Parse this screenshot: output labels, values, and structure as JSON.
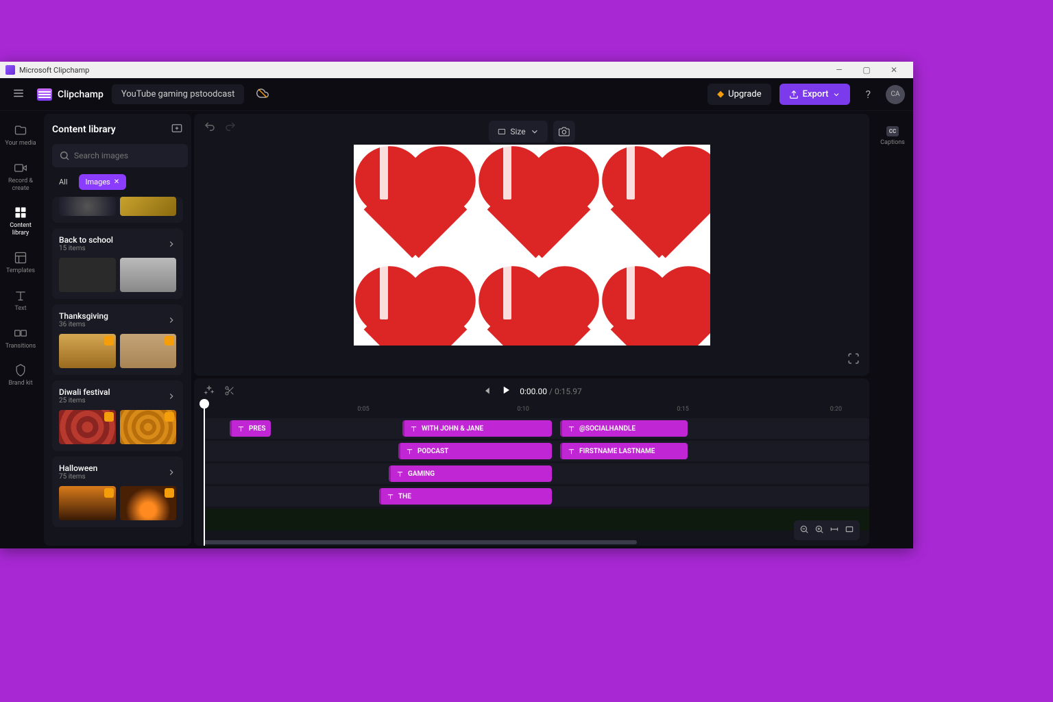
{
  "titlebar": {
    "title": "Microsoft Clipchamp"
  },
  "topbar": {
    "app_name": "Clipchamp",
    "project_name": "YouTube gaming pstoodcast",
    "upgrade": "Upgrade",
    "export": "Export",
    "avatar": "CA"
  },
  "left_nav": {
    "your_media": "Your media",
    "record_create": "Record & create",
    "content_library": "Content library",
    "templates": "Templates",
    "text": "Text",
    "transitions": "Transitions",
    "brand_kit": "Brand kit"
  },
  "right_nav": {
    "captions": "Captions",
    "cc": "CC"
  },
  "panel": {
    "title": "Content library",
    "search_placeholder": "Search images",
    "chips": {
      "all": "All",
      "images": "Images"
    },
    "cats": [
      {
        "title": "Back to school",
        "count": "15 items"
      },
      {
        "title": "Thanksgiving",
        "count": "36 items"
      },
      {
        "title": "Diwali festival",
        "count": "25 items"
      },
      {
        "title": "Halloween",
        "count": "75 items"
      }
    ]
  },
  "canvas": {
    "size_label": "Size"
  },
  "playback": {
    "current": "0:00.00",
    "sep": " / ",
    "duration": "0:15.97"
  },
  "ruler": {
    "t05": "0:05",
    "t10": "0:10",
    "t15": "0:15",
    "t20": "0:20"
  },
  "clips": {
    "c1": "PRES",
    "c2": "WITH JOHN & JANE",
    "c3": "@SOCIALHANDLE",
    "c4": "PODCAST",
    "c5": "FIRSTNAME LASTNAME",
    "c6": "GAMING",
    "c7": "THE"
  }
}
